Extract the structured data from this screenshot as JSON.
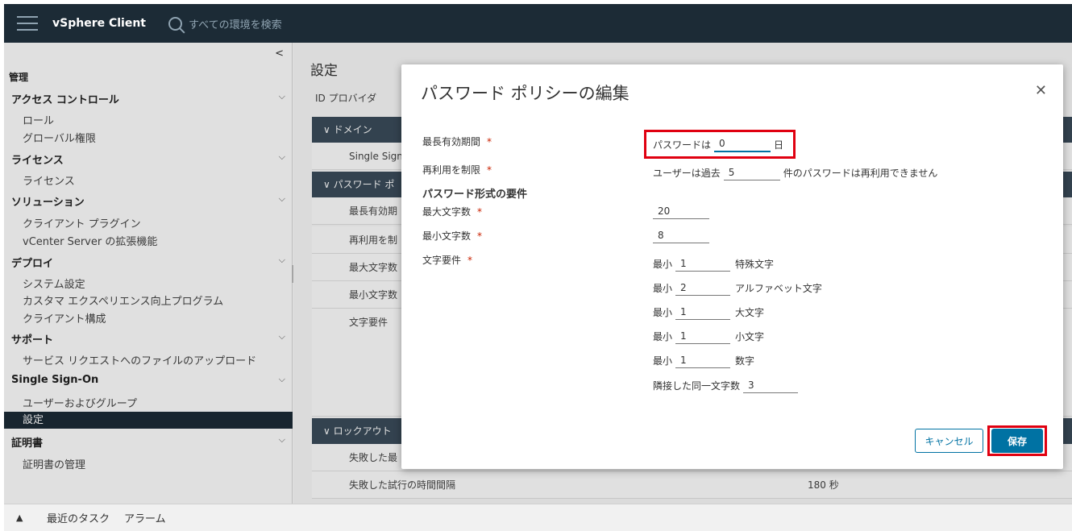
{
  "header": {
    "app_title": "vSphere Client",
    "search_placeholder": "すべての環境を検索"
  },
  "sidebar": {
    "collapse_glyph": "<",
    "section_title": "管理",
    "groups": [
      {
        "label": "アクセス コントロール",
        "items": [
          "ロール",
          "グローバル権限"
        ]
      },
      {
        "label": "ライセンス",
        "items": [
          "ライセンス"
        ]
      },
      {
        "label": "ソリューション",
        "items": [
          "クライアント プラグイン",
          "vCenter Server の拡張機能"
        ]
      },
      {
        "label": "デプロイ",
        "items": [
          "システム設定",
          "カスタマ エクスペリエンス向上プログラム",
          "クライアント構成"
        ]
      },
      {
        "label": "サポート",
        "items": [
          "サービス リクエストへのファイルのアップロード"
        ]
      },
      {
        "label": "Single Sign-On",
        "items": [
          "ユーザーおよびグループ",
          "設定"
        ]
      },
      {
        "label": "証明書",
        "items": [
          "証明書の管理"
        ]
      }
    ],
    "chevron": "⌵"
  },
  "main": {
    "page_title": "設定",
    "tab_label": "ID プロバイダ",
    "sections": {
      "domain": "∨  ドメイン",
      "password": "∨  パスワード ポ",
      "lockout": "∨  ロックアウト"
    },
    "rows": {
      "sso": "Single Sign",
      "max_lifetime": "最長有効期",
      "reuse": "再利用を制",
      "max_len": "最大文字数",
      "min_len": "最小文字数",
      "char_req": "文字要件",
      "failed": "失敗した最",
      "interval": "失敗した試行の時間間隔",
      "interval_value": "180 秒"
    }
  },
  "modal": {
    "title": "パスワード ポリシーの編集",
    "close": "✕",
    "required_mark": "*",
    "labels": {
      "max_lifetime": "最長有効期間",
      "reuse": "再利用を制限",
      "format_header": "パスワード形式の要件",
      "max_length": "最大文字数",
      "min_length": "最小文字数",
      "char_requirements": "文字要件"
    },
    "lifetime": {
      "prefix": "パスワードは",
      "value": "0",
      "suffix": "日"
    },
    "reuse": {
      "prefix": "ユーザーは過去",
      "value": "5",
      "suffix": "件のパスワードは再利用できません"
    },
    "max_length_value": "20",
    "min_length_value": "8",
    "char_reqs": [
      {
        "prefix": "最小",
        "value": "1",
        "suffix": "特殊文字"
      },
      {
        "prefix": "最小",
        "value": "2",
        "suffix": "アルファベット文字"
      },
      {
        "prefix": "最小",
        "value": "1",
        "suffix": "大文字"
      },
      {
        "prefix": "最小",
        "value": "1",
        "suffix": "小文字"
      },
      {
        "prefix": "最小",
        "value": "1",
        "suffix": "数字"
      }
    ],
    "adjacent": {
      "prefix": "隣接した同一文字数",
      "value": "3"
    },
    "cancel_label": "キャンセル",
    "save_label": "保存"
  },
  "bottombar": {
    "caret": "▲",
    "tabs": [
      "最近のタスク",
      "アラーム"
    ]
  },
  "colors": {
    "header_bg": "#1c2b36",
    "accent": "#0072a3",
    "highlight": "#e00010",
    "required": "#c92100"
  }
}
